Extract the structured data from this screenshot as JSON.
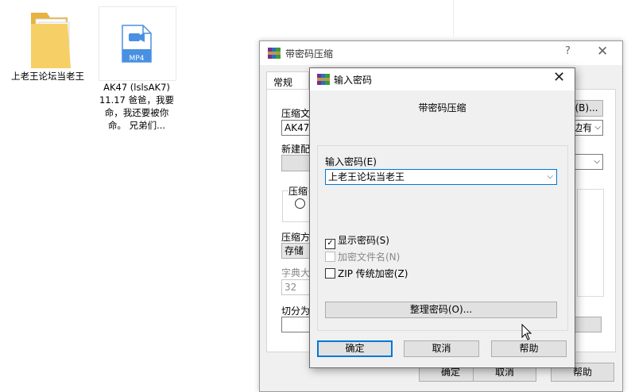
{
  "desktop": {
    "folder_label": "上老王论坛当老王",
    "video_label": "AK47 (lslsAK7) 11.17 爸爸，我要命，我还要被你命。 兄弟们...",
    "video_badge": "MP4"
  },
  "back_window": {
    "title": "带密码压缩",
    "help_glyph": "?",
    "close_glyph": "✕",
    "tab_general": "常规",
    "label_archive_name": "压缩文",
    "archive_name_value": "AK47 (",
    "label_new_profile": "新建配",
    "label_compress_format": "压缩",
    "label_compress_method": "压缩方",
    "compress_method_value": "存储",
    "label_dictionary": "字典大",
    "dictionary_value": "32",
    "label_split": "切分为",
    "browse_button": "(B)...",
    "update_mode_value": "边有",
    "ok_button": "确定",
    "cancel_button": "取消",
    "help_button": "帮助"
  },
  "dialog": {
    "title": "输入密码",
    "close_glyph": "✕",
    "heading": "带密码压缩",
    "password_label": "输入密码(E)",
    "password_value": "上老王论坛当老王",
    "show_password": "显示密码(S)",
    "encrypt_names": "加密文件名(N)",
    "zip_legacy": "ZIP 传统加密(Z)",
    "organize_button": "整理密码(O)...",
    "ok_button": "确定",
    "cancel_button": "取消",
    "help_button": "帮助",
    "show_password_checked": true,
    "encrypt_names_checked": false,
    "zip_legacy_checked": false
  },
  "colors": {
    "accent": "#0078d7",
    "folder": "#f3c75a",
    "video_icon": "#4a90e2"
  }
}
